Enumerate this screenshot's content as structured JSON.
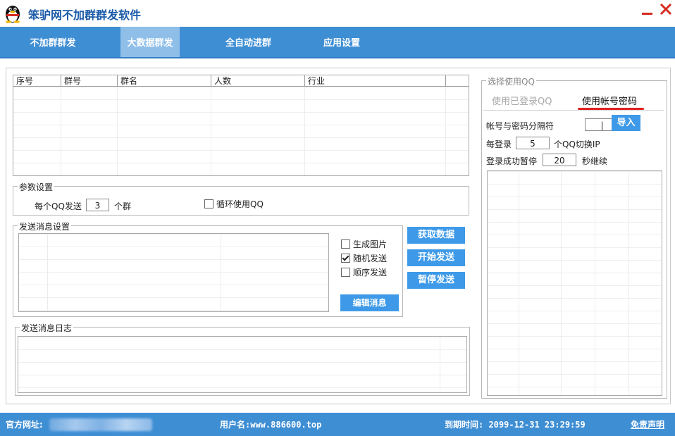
{
  "window": {
    "title": "笨驴网不加群群发软件",
    "min_icon": "minimize-icon",
    "close_icon": "close-icon"
  },
  "nav": {
    "tabs": [
      {
        "label": "不加群群发",
        "active": false
      },
      {
        "label": "大数据群发",
        "active": true
      },
      {
        "label": "全自动进群",
        "active": false
      },
      {
        "label": "应用设置",
        "active": false
      }
    ]
  },
  "group_table": {
    "columns": [
      "序号",
      "群号",
      "群名",
      "人数",
      "行业"
    ]
  },
  "params": {
    "legend": "参数设置",
    "per_qq_prefix": "每个QQ发送",
    "per_qq_value": "3",
    "per_qq_suffix": "个群",
    "loop_label": "循环使用QQ",
    "loop_checked": false
  },
  "message": {
    "legend": "发送消息设置",
    "options": [
      {
        "label": "生成图片",
        "checked": false
      },
      {
        "label": "随机发送",
        "checked": true
      },
      {
        "label": "顺序发送",
        "checked": false
      }
    ],
    "edit_button": "编辑消息"
  },
  "actions": {
    "fetch": "获取数据",
    "start": "开始发送",
    "pause": "暂停发送"
  },
  "log": {
    "legend": "发送消息日志"
  },
  "qq_select": {
    "legend": "选择使用QQ",
    "tab_logged": "使用已登录QQ",
    "tab_password": "使用帐号密码",
    "separator_label": "帐号与密码分隔符",
    "separator_value": "|",
    "import_button": "导入",
    "per_login_prefix": "每登录",
    "per_login_value": "5",
    "per_login_suffix": "个QQ切换IP",
    "pause_prefix": "登录成功暂停",
    "pause_value": "20",
    "pause_suffix": "秒继续"
  },
  "status": {
    "site_label": "官方网址:",
    "user_label": "用户名:www.886600.top",
    "expiry_label": "到期时间: 2099-12-31 23:29:59",
    "disclaimer": "免责声明"
  },
  "colors": {
    "nav_bg": "#3e8ed4",
    "nav_active": "#8fbfe9",
    "button": "#3e9ae8",
    "title": "#1a5aa8",
    "underline": "#e0201e"
  }
}
